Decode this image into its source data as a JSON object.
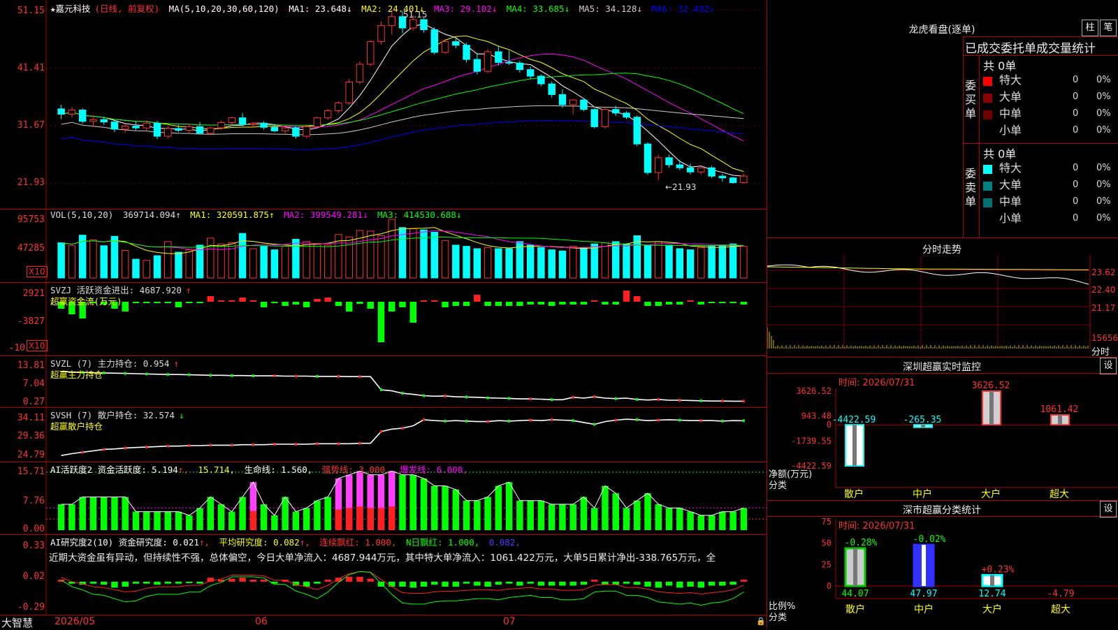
{
  "stock": {
    "name": "★嘉元科技",
    "mode": "(日线, 前复权)"
  },
  "colors": {
    "up": "#ff3232",
    "down": "#00ffff",
    "bg": "#000000",
    "grid": "#b00000",
    "axis_label": "#ff3030"
  },
  "kline": {
    "header": {
      "ma_label": "MA(5,10,20,30,60,120)",
      "items": [
        {
          "label": "MA1: 23.648",
          "arrow": "↓",
          "color": "#ffffff"
        },
        {
          "label": "MA2: 24.401",
          "arrow": "↓",
          "color": "#ffff00"
        },
        {
          "label": "MA3: 29.102",
          "arrow": "↓",
          "color": "#ff00ff"
        },
        {
          "label": "MA4: 33.685",
          "arrow": "↓",
          "color": "#00ff00"
        },
        {
          "label": "MA5: 34.128",
          "arrow": "↓",
          "color": "#cccccc"
        },
        {
          "label": "MA6: 32.492",
          "arrow": "↓",
          "color": "#0000ff"
        }
      ]
    },
    "y_labels": [
      "51.15",
      "41.41",
      "31.67",
      "21.93"
    ],
    "high_label": "51.15",
    "low_label": "←21.93"
  },
  "volume": {
    "header": [
      {
        "label": "VOL(5,10,20)",
        "color": "#dddddd"
      },
      {
        "label": "369714.094",
        "arrow": "↑",
        "color": "#dddddd"
      },
      {
        "label": "MA1: 320591.875",
        "arrow": "↑",
        "color": "#ffff00"
      },
      {
        "label": "MA2: 399549.281",
        "arrow": "↓",
        "color": "#ff00ff"
      },
      {
        "label": "MA3: 414530.688",
        "arrow": "↓",
        "color": "#00ff00"
      }
    ],
    "y_labels": [
      "95753",
      "47285"
    ],
    "unit": "X10"
  },
  "svzj": {
    "header": "SVZJ  活跃资金进出: 4687.920",
    "arrow": "↑",
    "sub": "超赢资金流(万元)",
    "y_labels": [
      "2921",
      "-3827",
      "-10"
    ],
    "unit": "X10"
  },
  "svzl": {
    "header": "SVZL (7) 主力持仓: 0.954",
    "arrow": "↑",
    "sub": "超赢主力持仓",
    "y_labels": [
      "13.81",
      "7.04",
      "0.27"
    ]
  },
  "svsh": {
    "header": "SVSH (7) 散户持仓: 32.574",
    "arrow": "↓",
    "sub": "超赢散户持仓",
    "y_labels": [
      "34.11",
      "29.36",
      "24.79"
    ]
  },
  "ai1": {
    "header_a": "AI活跃度2 资金活跃度: 5.194",
    "header_b": "15.714",
    "header_c": "生命线: 1.560",
    "header_d": "强势线: 3.000",
    "header_e": "爆发线: 6.000",
    "y_labels": [
      "15.71",
      "7.76",
      "0.00"
    ]
  },
  "ai2": {
    "header_a": "AI研究度2(10) 资金研究度: 0.021",
    "header_b": "平均研究度: 0.082",
    "header_c": "连续飘红: 1.000",
    "header_d": "N日飘红: 1.000",
    "header_e": "0.082",
    "news": "近期大资金虽有异动，但持续性不强，总体偏空，今日大单净流入：4687.944万元，其中特大单净流入：1061.422万元，大单5日累计净出-338.765万元，全",
    "y_labels": [
      "0.33",
      "0.02",
      "-0.29"
    ]
  },
  "xaxis": {
    "brand": "大智慧",
    "labels": [
      "2026/05",
      "06",
      "07"
    ]
  },
  "right": {
    "lhkp": {
      "title": "龙虎看盘(逐单)",
      "btn1": "柱",
      "btn2": "笔"
    },
    "order_title": "已成交委托单成交量统计",
    "buy": {
      "side": "委买单",
      "total": "共 0单",
      "rows": [
        {
          "label": "特大",
          "n": "0",
          "p": "0%",
          "color": "#ff0000"
        },
        {
          "label": "大单",
          "n": "0",
          "p": "0%",
          "color": "#8b0000"
        },
        {
          "label": "中单",
          "n": "0",
          "p": "0%",
          "color": "#700000"
        },
        {
          "label": "小单",
          "n": "0",
          "p": "0%",
          "color": "#000000"
        }
      ]
    },
    "sell": {
      "side": "委卖单",
      "total": "共 0单",
      "rows": [
        {
          "label": "特大",
          "n": "0",
          "p": "0%",
          "color": "#00ffff"
        },
        {
          "label": "大单",
          "n": "0",
          "p": "0%",
          "color": "#008080"
        },
        {
          "label": "中单",
          "n": "0",
          "p": "0%",
          "color": "#006f6f"
        },
        {
          "label": "小单",
          "n": "0",
          "p": "0%",
          "color": "#000000"
        }
      ]
    },
    "intraday": {
      "title": "分时走势",
      "y_labels": [
        "23.62",
        "22.40",
        "21.17"
      ],
      "vol_label": "15656",
      "bottom_label": "分时"
    },
    "monitor": {
      "title": "深圳超赢实时监控",
      "btn": "设",
      "time": "时间: 2026/07/31",
      "y_labels": [
        "3626.52",
        "943.48",
        "0",
        "-1739.55",
        "-4422.59"
      ],
      "categories": [
        "散户",
        "中户",
        "大户",
        "超大"
      ],
      "values": [
        -4422.59,
        -265.35,
        3626.52,
        1061.42
      ],
      "value_labels": [
        "-4422.59",
        "-265.35",
        "3626.52",
        "1061.42"
      ],
      "ylabel": "净额(万元)",
      "xlabel": "分类"
    },
    "classify": {
      "title": "深市超赢分类统计",
      "btn": "设",
      "time": "时间: 2026/07/31",
      "y_labels": [
        "75",
        "50",
        "25",
        "0"
      ],
      "categories": [
        "散户",
        "中户",
        "大户",
        "超大"
      ],
      "values": [
        44.07,
        47.97,
        12.74,
        -4.79
      ],
      "value_labels": [
        "44.07",
        "47.97",
        "12.74",
        "-4.79"
      ],
      "change_labels": [
        "-0.28%",
        "-0.02%",
        "+0.23%",
        ""
      ],
      "ylabel": "比例%",
      "xlabel": "分类"
    }
  },
  "chart_data": [
    {
      "type": "candlestick",
      "title": "★嘉元科技(日线, 前复权)",
      "ylim": [
        21.93,
        51.15
      ],
      "ohlc": [
        [
          34.5,
          35.2,
          32.8,
          33.6
        ],
        [
          33.6,
          34.8,
          33.0,
          34.3
        ],
        [
          34.3,
          34.6,
          32.0,
          32.4
        ],
        [
          32.4,
          33.4,
          31.5,
          32.7
        ],
        [
          32.7,
          33.2,
          31.8,
          32.3
        ],
        [
          32.3,
          32.6,
          30.6,
          31.1
        ],
        [
          31.1,
          32.0,
          30.5,
          31.6
        ],
        [
          31.6,
          32.4,
          30.9,
          31.3
        ],
        [
          31.3,
          32.6,
          30.7,
          32.1
        ],
        [
          32.1,
          32.5,
          29.4,
          29.9
        ],
        [
          29.9,
          31.6,
          29.5,
          31.2
        ],
        [
          31.2,
          31.8,
          30.6,
          30.9
        ],
        [
          30.9,
          32.0,
          30.5,
          31.5
        ],
        [
          31.5,
          32.3,
          30.9,
          30.4
        ],
        [
          30.4,
          31.5,
          30.1,
          31.3
        ],
        [
          31.3,
          32.5,
          31.0,
          32.2
        ],
        [
          32.2,
          33.2,
          31.7,
          33.0
        ],
        [
          33.0,
          33.8,
          31.6,
          31.9
        ],
        [
          31.9,
          32.3,
          31.4,
          32.1
        ],
        [
          32.1,
          32.4,
          31.0,
          31.4
        ],
        [
          31.4,
          32.0,
          30.6,
          30.8
        ],
        [
          30.8,
          31.6,
          30.3,
          31.3
        ],
        [
          31.3,
          31.6,
          29.5,
          29.9
        ],
        [
          29.9,
          31.9,
          29.6,
          31.5
        ],
        [
          31.5,
          33.2,
          31.2,
          33.0
        ],
        [
          33.0,
          34.5,
          32.7,
          34.2
        ],
        [
          34.2,
          35.8,
          33.8,
          35.5
        ],
        [
          35.5,
          39.5,
          35.2,
          39.0
        ],
        [
          39.0,
          42.5,
          38.6,
          42.0
        ],
        [
          42.0,
          46.0,
          41.7,
          45.8
        ],
        [
          45.8,
          49.2,
          45.3,
          48.5
        ],
        [
          48.5,
          51.15,
          47.0,
          50.0
        ],
        [
          50.0,
          51.0,
          47.2,
          48.1
        ],
        [
          48.1,
          50.2,
          47.6,
          49.5
        ],
        [
          49.5,
          49.7,
          47.3,
          47.8
        ],
        [
          47.8,
          48.2,
          43.6,
          44.0
        ],
        [
          44.0,
          46.2,
          43.7,
          45.8
        ],
        [
          45.8,
          46.5,
          44.7,
          45.2
        ],
        [
          45.2,
          45.6,
          42.3,
          42.8
        ],
        [
          42.8,
          43.9,
          40.3,
          40.8
        ],
        [
          40.8,
          44.5,
          40.5,
          44.1
        ],
        [
          44.1,
          45.1,
          41.8,
          42.3
        ],
        [
          42.3,
          44.3,
          41.9,
          42.2
        ],
        [
          42.2,
          42.6,
          40.6,
          41.1
        ],
        [
          41.1,
          41.6,
          39.5,
          40.0
        ],
        [
          40.0,
          40.3,
          38.3,
          38.7
        ],
        [
          38.7,
          39.1,
          36.4,
          36.9
        ],
        [
          36.9,
          37.8,
          34.7,
          35.2
        ],
        [
          35.2,
          36.2,
          33.6,
          36.0
        ],
        [
          36.0,
          36.3,
          34.1,
          34.4
        ],
        [
          34.4,
          34.6,
          31.2,
          31.5
        ],
        [
          31.5,
          34.8,
          31.2,
          34.4
        ],
        [
          34.4,
          35.0,
          33.3,
          33.8
        ],
        [
          33.8,
          34.1,
          32.8,
          33.1
        ],
        [
          33.1,
          33.4,
          28.2,
          28.6
        ],
        [
          28.6,
          28.9,
          23.4,
          23.8
        ],
        [
          23.8,
          26.8,
          22.5,
          26.3
        ],
        [
          26.3,
          26.8,
          24.6,
          25.1
        ],
        [
          25.1,
          25.9,
          24.2,
          24.6
        ],
        [
          24.6,
          25.3,
          23.5,
          23.9
        ],
        [
          23.9,
          24.8,
          23.5,
          24.6
        ],
        [
          24.6,
          24.9,
          22.9,
          23.2
        ],
        [
          23.2,
          23.6,
          22.3,
          22.9
        ],
        [
          22.9,
          23.1,
          21.93,
          22.1
        ],
        [
          22.1,
          23.6,
          21.9,
          23.2
        ]
      ]
    },
    {
      "type": "bar",
      "title": "VOL(5,10,20)",
      "unit": "X10",
      "values": [
        60,
        55,
        73,
        65,
        55,
        71,
        47,
        32,
        30,
        38,
        62,
        44,
        48,
        56,
        68,
        58,
        60,
        76,
        50,
        54,
        48,
        54,
        66,
        62,
        58,
        56,
        74,
        70,
        81,
        80,
        72,
        100,
        86,
        84,
        82,
        78,
        64,
        56,
        54,
        50,
        52,
        50,
        50,
        62,
        56,
        52,
        48,
        46,
        54,
        52,
        58,
        60,
        62,
        58,
        72,
        56,
        62,
        56,
        50,
        48,
        52,
        54,
        56,
        58,
        54
      ]
    },
    {
      "type": "bar",
      "title": "SVZJ 活跃资金进出",
      "unit": "X10",
      "values": [
        -10,
        -18,
        -24,
        -2,
        -4,
        -10,
        -14,
        -2,
        -1,
        -2,
        -2,
        -8,
        -2,
        -2,
        8,
        2,
        2,
        6,
        2,
        -8,
        -2,
        -6,
        -4,
        -8,
        4,
        6,
        -6,
        -14,
        -3,
        -10,
        -58,
        -14,
        -8,
        -30,
        2,
        2,
        -8,
        -6,
        -6,
        10,
        -6,
        -6,
        -6,
        -6,
        -4,
        -4,
        -6,
        -4,
        -4,
        -4,
        2,
        -4,
        -4,
        16,
        8,
        -6,
        -6,
        -4,
        -4,
        2,
        -4,
        -2,
        -2,
        -2,
        -4
      ]
    },
    {
      "type": "line",
      "title": "SVZL (7) 主力持仓",
      "ylim": [
        0.27,
        13.81
      ],
      "values": [
        12.0,
        11.8,
        11.7,
        11.6,
        11.5,
        11.4,
        11.3,
        11.2,
        11.1,
        11.0,
        10.9,
        10.9,
        10.8,
        10.7,
        10.6,
        10.6,
        10.5,
        10.5,
        10.4,
        10.4,
        10.4,
        10.3,
        10.3,
        10.3,
        10.2,
        10.2,
        10.2,
        10.1,
        10.1,
        10.1,
        5.2,
        4.8,
        3.9,
        3.5,
        3.0,
        2.8,
        2.9,
        2.6,
        2.5,
        2.4,
        2.2,
        2.1,
        2.0,
        1.8,
        1.8,
        1.7,
        1.5,
        1.5,
        2.4,
        2.1,
        2.6,
        2.1,
        1.9,
        2.1,
        1.6,
        1.4,
        1.6,
        1.3,
        1.3,
        1.2,
        1.1,
        1.0,
        1.0,
        0.954,
        0.954
      ]
    },
    {
      "type": "line",
      "title": "SVSH (7) 散户持仓",
      "ylim": [
        24.79,
        34.11
      ],
      "values": [
        25.2,
        25.6,
        25.9,
        26.2,
        26.5,
        26.6,
        26.8,
        26.9,
        27.0,
        27.1,
        27.2,
        27.2,
        27.3,
        27.3,
        27.4,
        27.4,
        27.4,
        27.5,
        27.5,
        27.5,
        27.6,
        27.6,
        27.6,
        27.6,
        27.7,
        27.7,
        27.7,
        27.7,
        27.8,
        27.8,
        30.3,
        30.8,
        31.0,
        31.5,
        32.8,
        32.6,
        32.5,
        32.6,
        32.5,
        32.4,
        32.4,
        32.6,
        32.5,
        32.6,
        32.7,
        32.6,
        32.8,
        32.7,
        32.6,
        32.2,
        31.8,
        32.4,
        32.7,
        32.9,
        32.8,
        32.6,
        32.7,
        32.8,
        32.7,
        32.6,
        32.6,
        32.6,
        32.5,
        32.6,
        32.574
      ]
    },
    {
      "type": "bar",
      "title": "AI活跃度2 资金活跃度",
      "ylim": [
        0,
        15.71
      ],
      "values": [
        7,
        7,
        9,
        9,
        9,
        9,
        9,
        5,
        5,
        5,
        5,
        5,
        4,
        6,
        9,
        7,
        5,
        9,
        13,
        7,
        4,
        9,
        5,
        6,
        8,
        9,
        14,
        15,
        16,
        15,
        15,
        16,
        15,
        15,
        14,
        12,
        12,
        11,
        8,
        8,
        9,
        12,
        13,
        8,
        8,
        8,
        7,
        7,
        7,
        9,
        6,
        12,
        10,
        6,
        8,
        10,
        7,
        6,
        6,
        5,
        4,
        4,
        5,
        5,
        6
      ]
    },
    {
      "type": "bar",
      "title": "AI研究度2(10) 资金研究度",
      "ylim": [
        -0.29,
        0.33
      ],
      "values": [
        0.02,
        -0.02,
        -0.03,
        -0.02,
        -0.03,
        -0.06,
        -0.05,
        -0.02,
        -0.02,
        -0.03,
        -0.02,
        -0.02,
        -0.01,
        -0.02,
        0.04,
        0.02,
        0.03,
        0.04,
        0.02,
        0.02,
        -0.02,
        0.02,
        -0.04,
        -0.05,
        -0.02,
        0.02,
        0.04,
        0.05,
        0.05,
        0.03,
        -0.05,
        -0.05,
        -0.05,
        -0.06,
        -0.05,
        -0.03,
        -0.05,
        -0.05,
        -0.02,
        -0.04,
        -0.05,
        -0.03,
        -0.02,
        -0.04,
        -0.02,
        -0.04,
        -0.04,
        -0.04,
        -0.04,
        -0.03,
        0.02,
        -0.03,
        -0.03,
        -0.02,
        -0.03,
        -0.05,
        -0.06,
        -0.04,
        -0.06,
        -0.05,
        -0.06,
        -0.04,
        -0.04,
        -0.03,
        0.021
      ]
    }
  ]
}
